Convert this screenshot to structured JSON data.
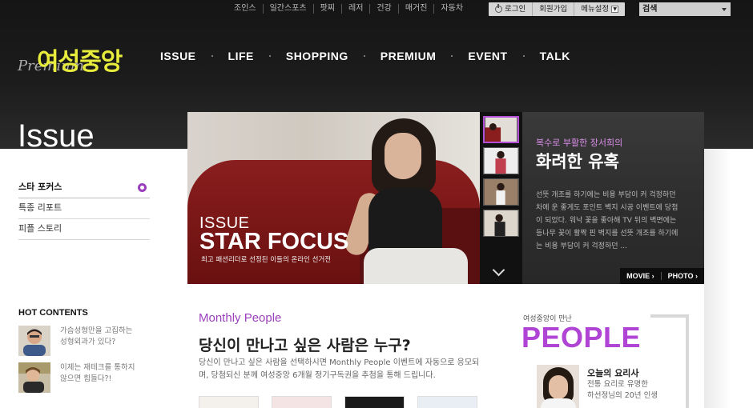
{
  "top_links": [
    "조인스",
    "일간스포츠",
    "팟찌",
    "레저",
    "건강",
    "매거진",
    "자동차"
  ],
  "top_buttons": {
    "login": "로그인",
    "join": "회원가입",
    "menu_setting": "메뉴설정"
  },
  "search": {
    "label": "검색"
  },
  "logo": {
    "premium": "Premium",
    "main": "여성중앙"
  },
  "nav": [
    "ISSUE",
    "LIFE",
    "SHOPPING",
    "PREMIUM",
    "EVENT",
    "TALK"
  ],
  "section_title": "Issue",
  "left_menu": [
    {
      "label": "스타 포커스",
      "active": true
    },
    {
      "label": "특종 리포트",
      "active": false
    },
    {
      "label": "피플 스토리",
      "active": false
    }
  ],
  "hot_contents": {
    "title": "HOT CONTENTS",
    "items": [
      {
        "line1": "가슴성형만을 고집하는",
        "line2": "성형외과가 있다?"
      },
      {
        "line1": "이제는 재테크를 통하지",
        "line2": "않으면 힘들다?!"
      }
    ]
  },
  "banner": {
    "issue": "ISSUE",
    "title": "STAR FOCUS",
    "subtitle": "최고 패션리더로 선정된 이들의 온라인 선거전",
    "article_sub": "복수로 부활한 장서희의",
    "article_title": "화려한 유혹",
    "article_body": "선뜻 개조를 하기에는 비용 부담이 커 걱정하던 차에 운 좋게도 포인트 벽지 시공 이벤트에 당첨이 되었다. 워낙 꽃을 좋아해 TV 뒤의 벽면에는 등나무 꽃이 활짝 핀 벽지를 선뜻 개조를 하기에는 비용 부담이 커 걱정하던 ...",
    "movie_btn": "MOVIE",
    "photo_btn": "PHOTO",
    "thumb_colors": [
      "#cfc7c0",
      "#d8b8b0",
      "#8a7058",
      "#c8c0b8"
    ]
  },
  "monthly_people": {
    "label": "Monthly People",
    "title": "당신이 만나고 싶은 사람은 누구?",
    "desc": "당신이 만나고 싶은 사람을 선택하시면 Monthly People 이벤트에 자동으로 응모되며, 당첨되신 분께 여성중앙 6개월 정기구독권을 추첨을 통해 드립니다."
  },
  "people": {
    "sub": "여성중앙이 만난",
    "big": "PEOPLE",
    "name": "오늘의 요리사",
    "desc_line1": "전통 요리로 유명한",
    "desc_line2": "하선정님의 20년 인생"
  },
  "colors": {
    "accent": "#9b3fbd",
    "logo_yellow": "#e8ec3c",
    "people_purple": "#b044d4"
  }
}
